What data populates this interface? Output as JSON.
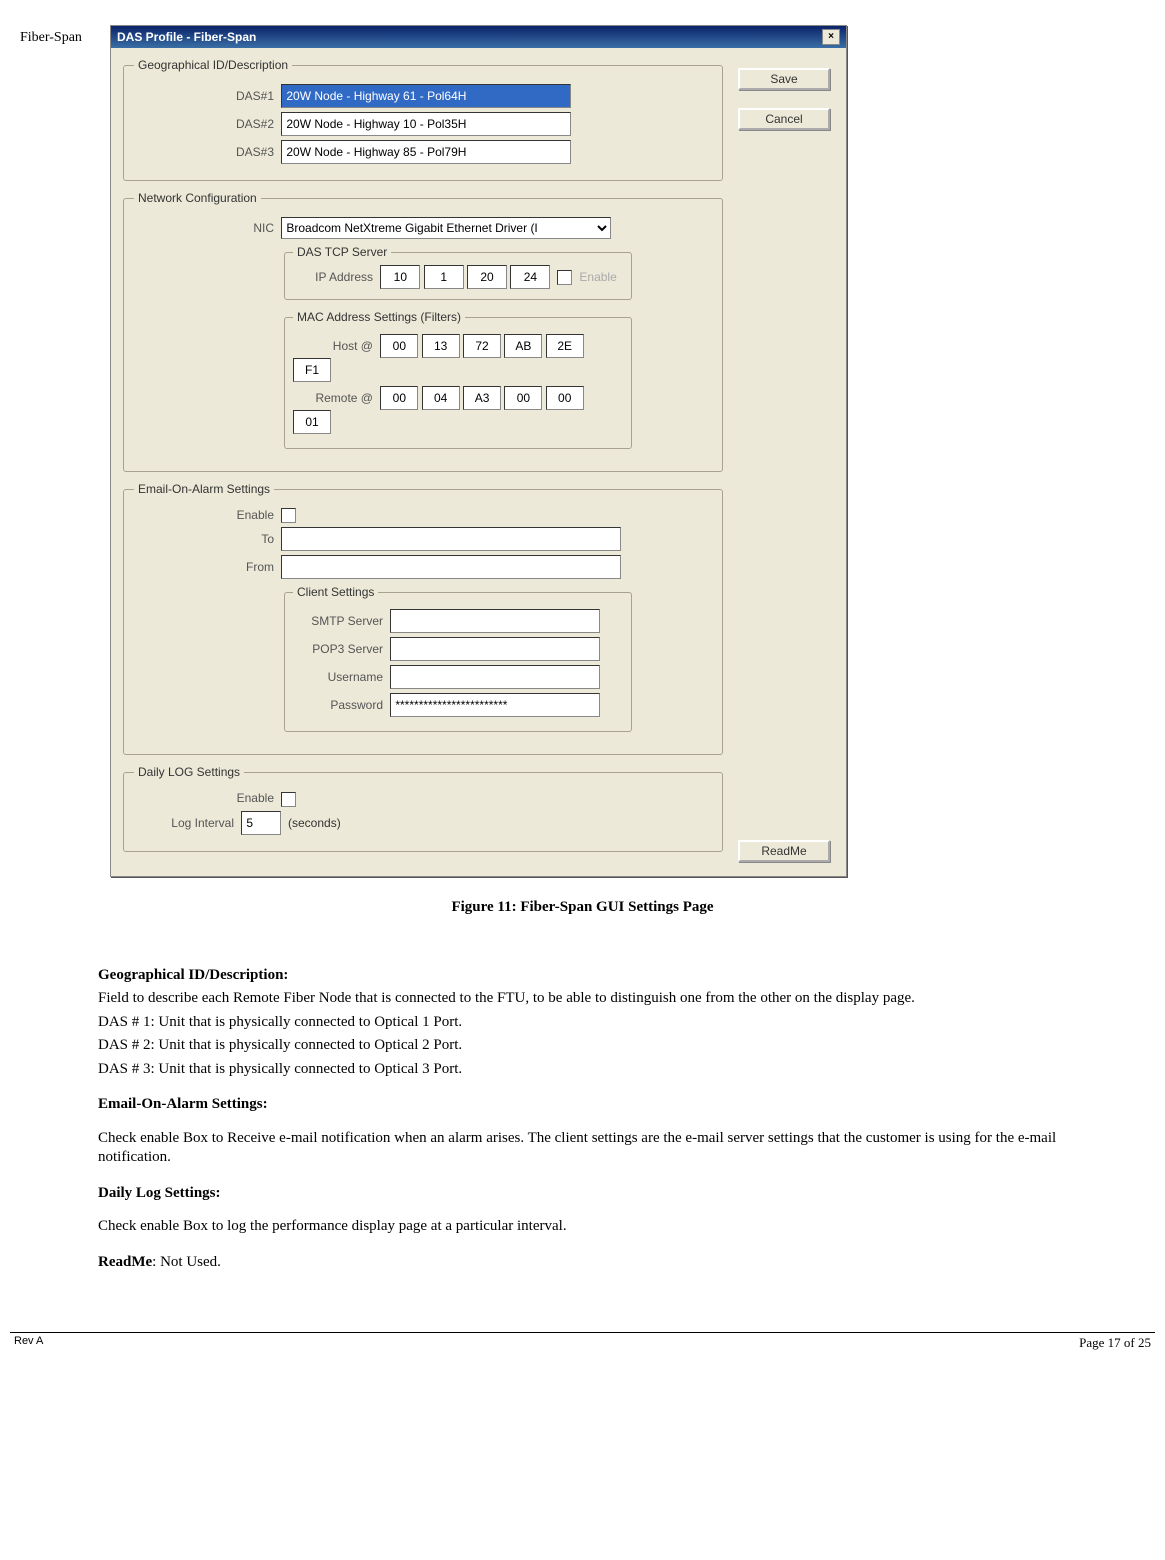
{
  "header_label": "Fiber-Span",
  "dialog": {
    "title": "DAS Profile -  Fiber-Span",
    "close_glyph": "×",
    "buttons": {
      "save": "Save",
      "cancel": "Cancel",
      "readme": "ReadMe"
    },
    "geo": {
      "legend": "Geographical ID/Description",
      "das1_label": "DAS#1",
      "das1_value": "20W Node - Highway 61 - Pol64H",
      "das2_label": "DAS#2",
      "das2_value": "20W Node - Highway 10 - Pol35H",
      "das3_label": "DAS#3",
      "das3_value": "20W Node - Highway 85 - Pol79H"
    },
    "net": {
      "legend": "Network Configuration",
      "nic_label": "NIC",
      "nic_value": "Broadcom NetXtreme Gigabit Ethernet Driver (I",
      "tcp_legend": "DAS TCP Server",
      "ip_label": "IP Address",
      "ip": [
        "10",
        "1",
        "20",
        "24"
      ],
      "enable_label": "Enable",
      "mac_legend": "MAC Address Settings (Filters)",
      "host_label": "Host @",
      "host": [
        "00",
        "13",
        "72",
        "AB",
        "2E",
        "F1"
      ],
      "remote_label": "Remote @",
      "remote": [
        "00",
        "04",
        "A3",
        "00",
        "00",
        "01"
      ]
    },
    "email": {
      "legend": "Email-On-Alarm Settings",
      "enable_label": "Enable",
      "to_label": "To",
      "to_value": "",
      "from_label": "From",
      "from_value": "",
      "client_legend": "Client Settings",
      "smtp_label": "SMTP Server",
      "smtp_value": "",
      "pop3_label": "POP3 Server",
      "pop3_value": "",
      "user_label": "Username",
      "user_value": "",
      "pass_label": "Password",
      "pass_value": "************************"
    },
    "log": {
      "legend": "Daily LOG Settings",
      "enable_label": "Enable",
      "interval_label": "Log Interval",
      "interval_value": "5",
      "seconds": "(seconds)"
    }
  },
  "caption": "Figure 11: Fiber-Span GUI Settings Page",
  "doc": {
    "h1": "Geographical ID/Description:",
    "p1": "Field to describe each Remote Fiber Node that is connected to the FTU, to be able to distinguish one from the other on the display page.",
    "p2": "DAS # 1: Unit that is physically connected to Optical 1 Port.",
    "p3": "DAS # 2: Unit that is physically connected to Optical 2 Port.",
    "p4": "DAS # 3: Unit that is physically connected to Optical 3 Port.",
    "h2": "Email-On-Alarm Settings:",
    "p5": "Check enable Box to Receive e-mail notification when an alarm arises. The client settings are the e-mail server settings that the customer is using for the e-mail notification.",
    "h3": "Daily Log Settings:",
    "p6": "Check enable Box to log the performance display page at a particular interval.",
    "h4_strong": "ReadMe",
    "h4_rest": ": Not Used."
  },
  "footer": {
    "left": "Rev A",
    "right_pre": "Page ",
    "page": "17",
    "of": " of ",
    "total": "25"
  }
}
